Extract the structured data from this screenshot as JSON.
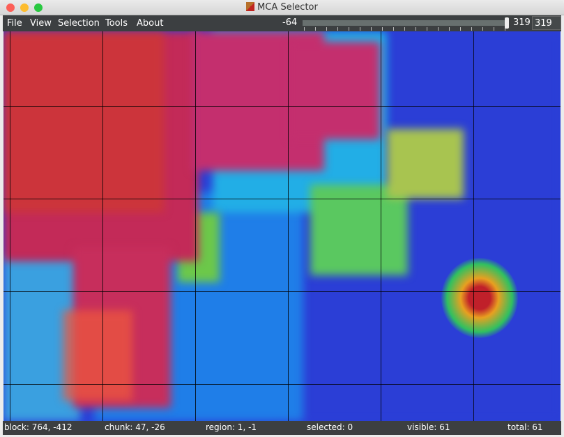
{
  "window": {
    "title": "MCA Selector"
  },
  "menu": {
    "items": [
      "File",
      "View",
      "Selection",
      "Tools",
      "About"
    ]
  },
  "height_slider": {
    "min_label": "-64",
    "value_label": "319",
    "input_value": "319",
    "fraction": 1.0
  },
  "status": {
    "block": "block: 764, -412",
    "chunk": "chunk: 47, -26",
    "region": "region: 1, -1",
    "selected": "selected: 0",
    "visible": "visible: 61",
    "total": "total: 61"
  },
  "colors": {
    "menubar": "#3c3f41",
    "heat_high": "#c0204a",
    "heat_mid": "#22c08a",
    "heat_low": "#2a3fd8"
  }
}
